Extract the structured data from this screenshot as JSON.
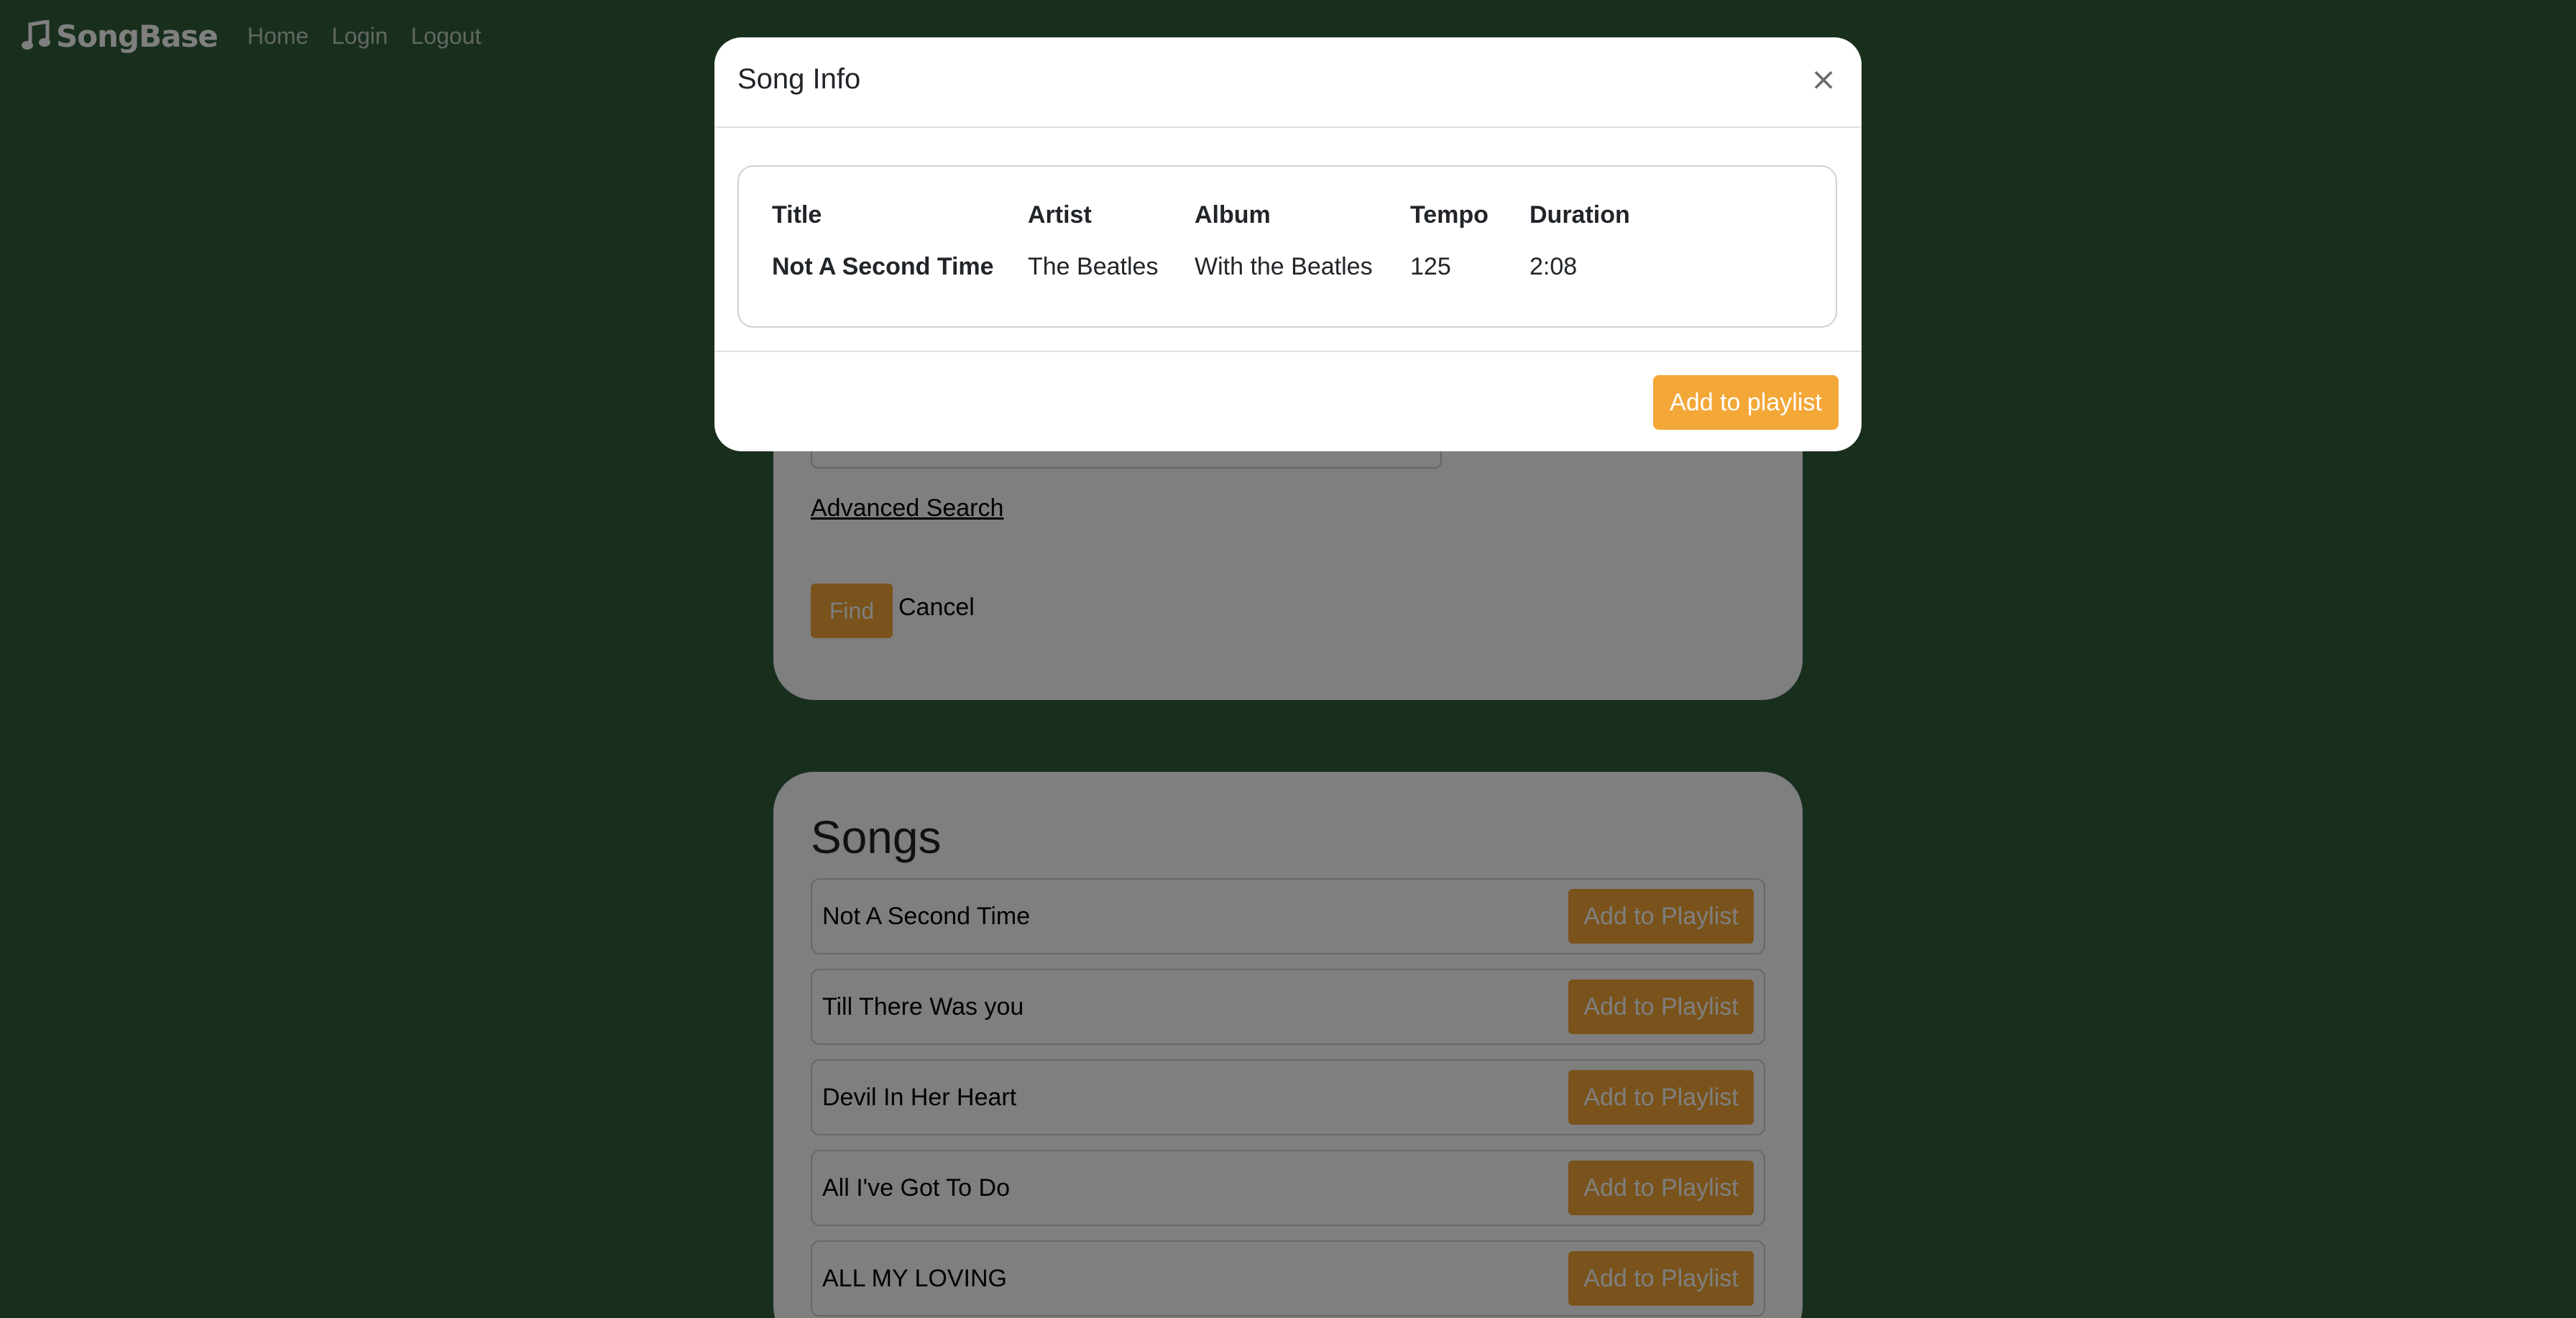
{
  "navbar": {
    "brand": "SongBase",
    "links": [
      "Home",
      "Login",
      "Logout"
    ]
  },
  "search": {
    "input_value": "",
    "advanced_search_label": "Advanced Search",
    "find_label": "Find",
    "cancel_label": "Cancel"
  },
  "songs": {
    "title": "Songs",
    "add_label": "Add to Playlist",
    "items": [
      "Not A Second Time",
      "Till There Was you",
      "Devil In Her Heart",
      "All I've Got To Do",
      "ALL MY LOVING"
    ]
  },
  "modal": {
    "title": "Song Info",
    "close_symbol": "×",
    "headers": [
      "Title",
      "Artist",
      "Album",
      "Tempo",
      "Duration"
    ],
    "row": {
      "title": "Not A Second Time",
      "artist": "The Beatles",
      "album": "With the Beatles",
      "tempo": "125",
      "duration": "2:08"
    },
    "add_button": "Add to playlist"
  },
  "colors": {
    "background": "#335e3b",
    "accent": "#f3a737",
    "card": "#ffffff"
  }
}
